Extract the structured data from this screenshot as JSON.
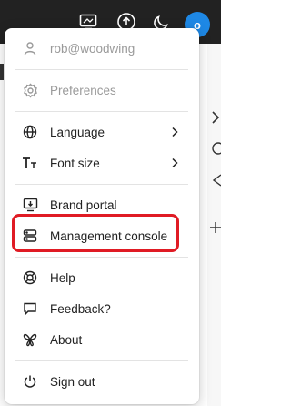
{
  "topbar": {
    "avatar_initial": "o",
    "icons": [
      "monitor-icon",
      "upload-icon",
      "moon-icon"
    ]
  },
  "menu": {
    "account": "rob@woodwing",
    "preferences": "Preferences",
    "language": "Language",
    "font_size": "Font size",
    "brand_portal": "Brand portal",
    "management_console": "Management console",
    "help": "Help",
    "feedback": "Feedback?",
    "about": "About",
    "sign_out": "Sign out"
  },
  "colors": {
    "highlight": "#e01b24",
    "avatar": "#1e88e5",
    "topbar": "#222222"
  }
}
